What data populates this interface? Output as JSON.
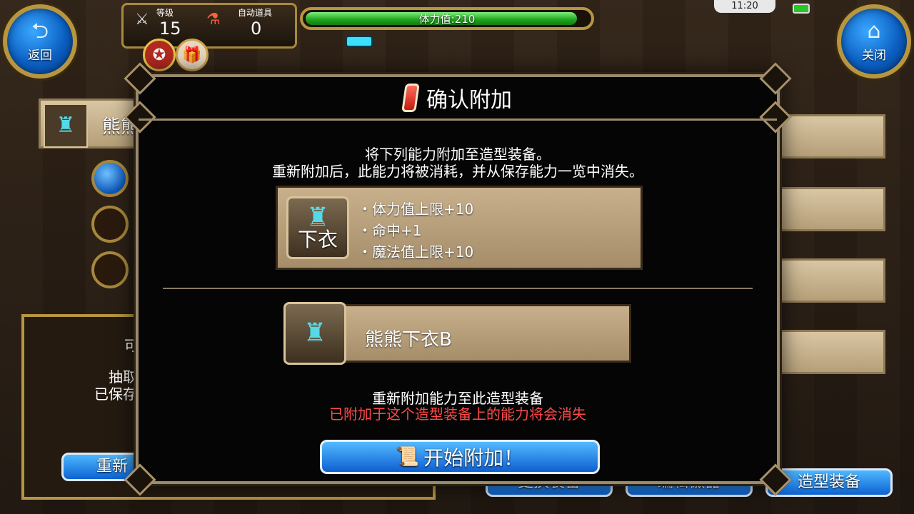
{
  "hud": {
    "back_label": "返回",
    "close_label": "关闭",
    "level_caption": "等级",
    "level_value": "15",
    "auto_item_caption": "自动道具",
    "auto_item_value": "0",
    "hp_text": "体力值:210",
    "hp_fraction": 0.96,
    "clock": "11:20"
  },
  "background": {
    "equip_name_partial": "熊熊",
    "side_text_line1": "可",
    "side_text_line2": "抽取",
    "side_text_line3": "已保存",
    "re_attach_partial": "重新",
    "tabs": [
      "更换装备",
      "编辑徽器",
      "造型装备"
    ]
  },
  "modal": {
    "title": "确认附加",
    "intro_line1": "将下列能力附加至造型装备。",
    "intro_line2": "重新附加后，此能力将被消耗，并从保存能力一览中消失。",
    "source_slot_label": "下衣",
    "abilities": [
      "・体力值上限+10",
      "・命中+1",
      "・魔法值上限+10"
    ],
    "target_item_name": "熊熊下衣B",
    "notice_line1": "重新附加能力至此造型装备",
    "notice_warning": "已附加于这个造型装备上的能力将会消失",
    "start_button": "开始附加！"
  },
  "colors": {
    "warning_red": "#ff4a4a",
    "button_blue": "#0e5fd1",
    "frame_gold": "#b8963f"
  }
}
